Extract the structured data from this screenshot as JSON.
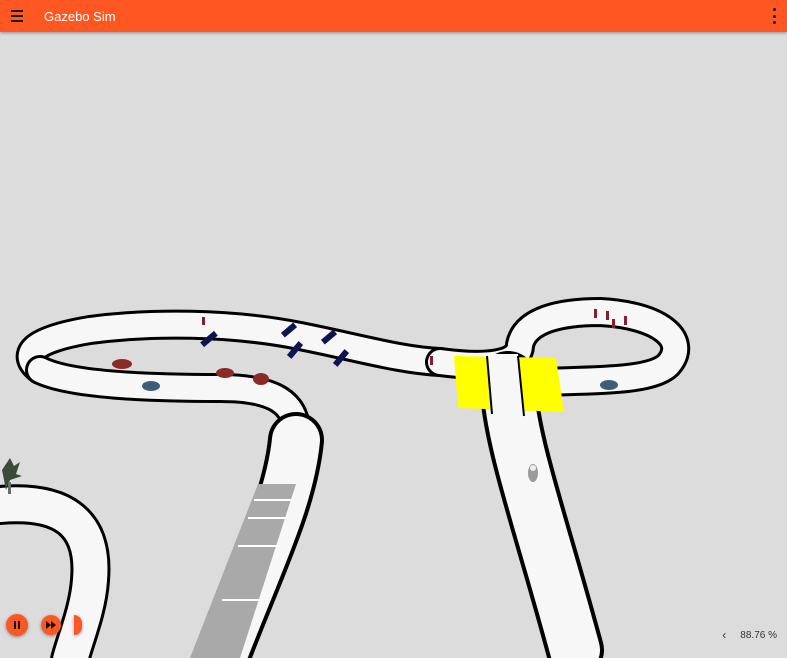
{
  "app": {
    "title": "Gazebo Sim"
  },
  "icons": {
    "menu": "hamburger-menu-icon",
    "options": "kebab-menu-icon",
    "pause": "pause-icon",
    "step": "fast-forward-icon",
    "collapse": "chevron-left-icon"
  },
  "colors": {
    "accent": "#ff5722",
    "background": "#dcdcdc",
    "road": "#f7f7f7",
    "road_edge": "#000000",
    "crosswalk": "#ffff00",
    "ramp": "#a9a9a9",
    "obstacle": "#0d1550",
    "pylon": "#8b1e2a",
    "car_red": "#8a2b25",
    "car_blue": "#3e5e78"
  },
  "status": {
    "real_time_factor": "88.76 %"
  }
}
